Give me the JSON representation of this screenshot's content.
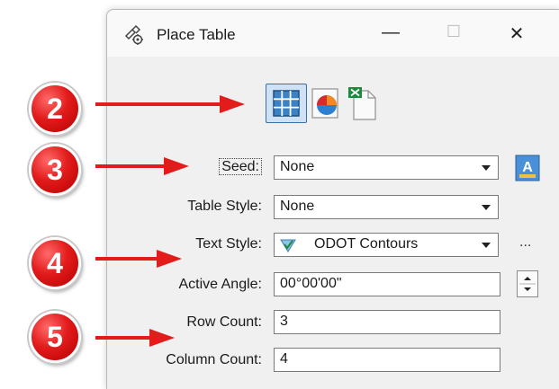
{
  "window": {
    "title": "Place Table",
    "minimize": "—",
    "maximize": "☐",
    "close": "✕"
  },
  "toolbar": {
    "modes": [
      {
        "name": "grid-table-mode",
        "active": true
      },
      {
        "name": "pie-chart-mode",
        "active": false
      },
      {
        "name": "excel-import-mode",
        "active": false
      }
    ]
  },
  "form": {
    "seed": {
      "label": "Seed:",
      "value": "None"
    },
    "table_style": {
      "label": "Table Style:",
      "value": "None"
    },
    "text_style": {
      "label": "Text Style:",
      "value": "ODOT Contours",
      "icon": "text-style-icon"
    },
    "active_angle": {
      "label": "Active Angle:",
      "value": "00°00'00\""
    },
    "row_count": {
      "label": "Row Count:",
      "value": "3"
    },
    "column_count": {
      "label": "Column Count:",
      "value": "4"
    },
    "more_button": "..."
  },
  "annotations": {
    "badges": [
      "2",
      "3",
      "4",
      "5"
    ],
    "color": "#e21b1b"
  }
}
